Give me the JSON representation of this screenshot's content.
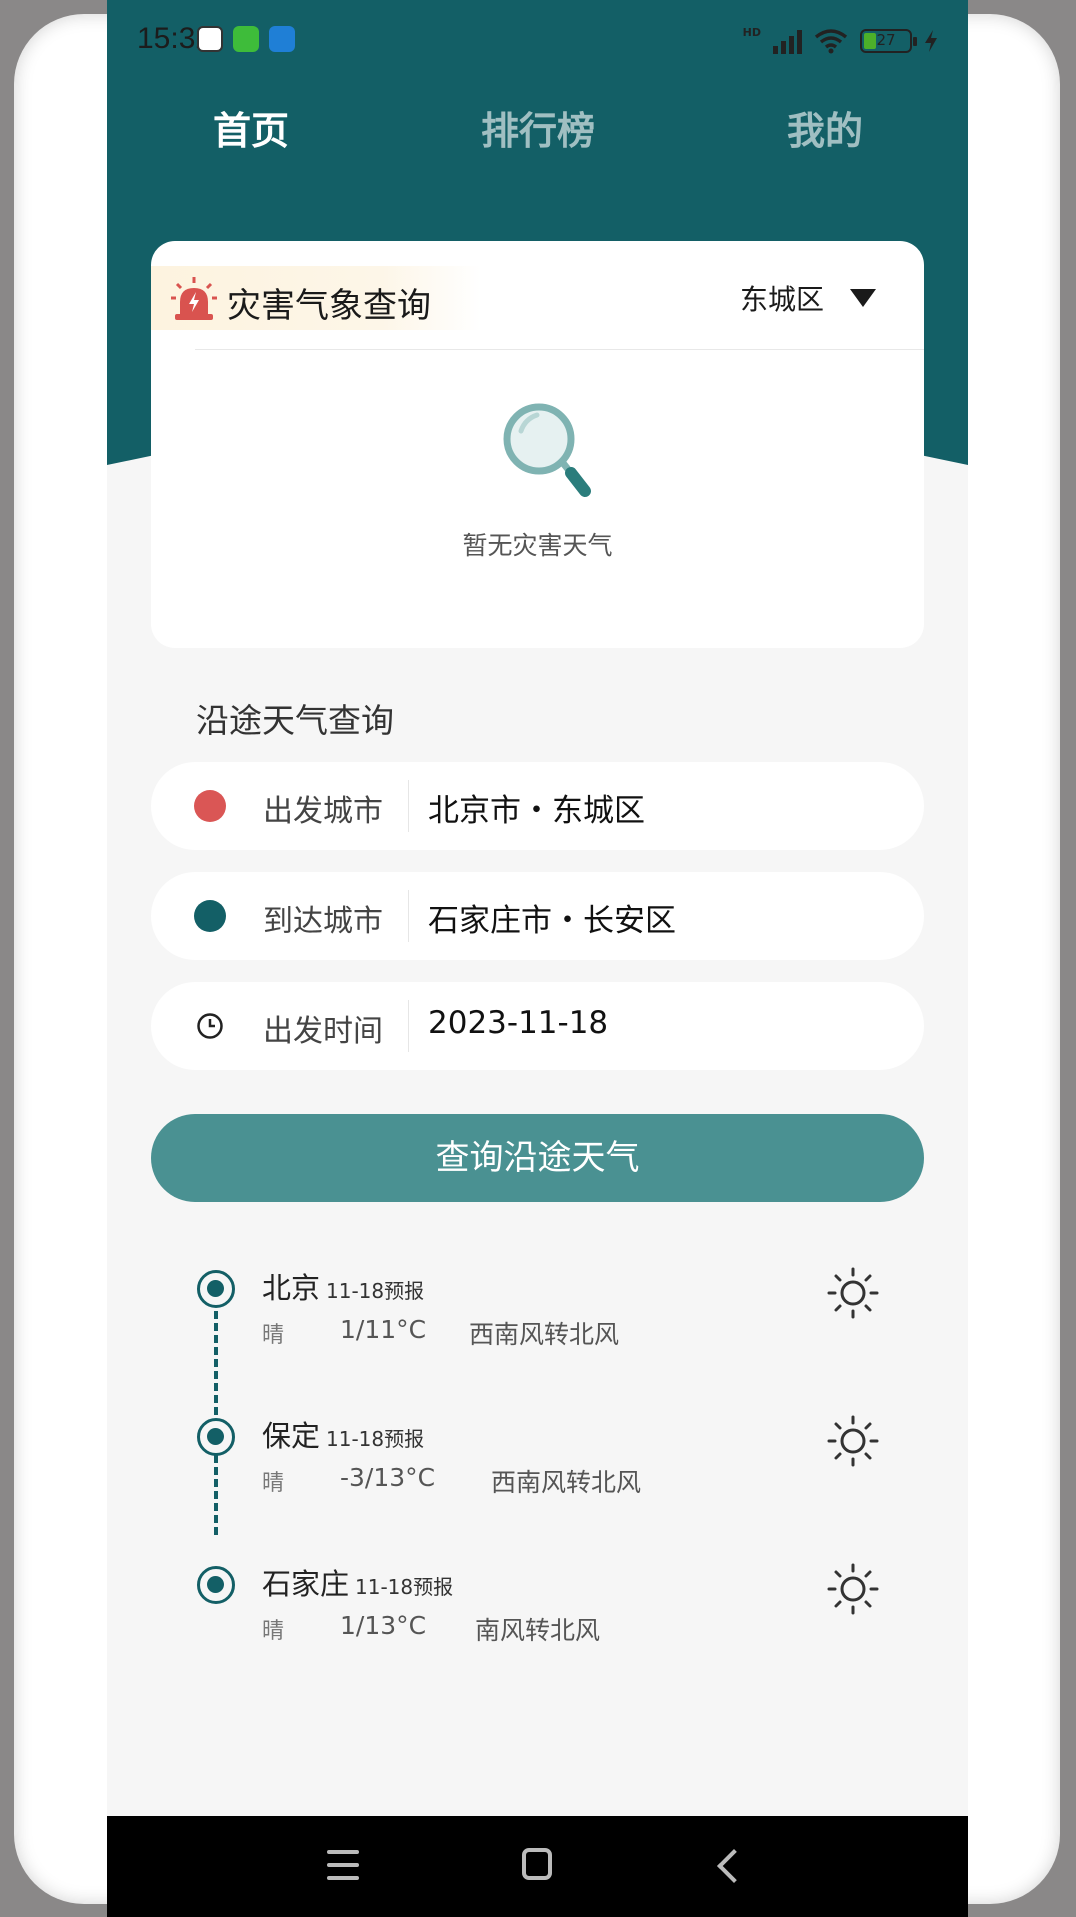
{
  "status_bar": {
    "time": "15:32",
    "app_icons": [
      "robot-app-icon",
      "smile-app-icon",
      "blue-app-icon"
    ],
    "network_label": "HD",
    "battery_level": "27",
    "charging": true
  },
  "tabs": [
    {
      "label": "首页",
      "active": true
    },
    {
      "label": "排行榜",
      "active": false
    },
    {
      "label": "我的",
      "active": false
    }
  ],
  "disaster": {
    "title": "灾害气象查询",
    "region": "东城区",
    "empty_text": "暂无灾害天气"
  },
  "route": {
    "title": "沿途天气查询",
    "departure": {
      "label": "出发城市",
      "value": "北京市・东城区"
    },
    "arrival": {
      "label": "到达城市",
      "value": "石家庄市・长安区"
    },
    "time": {
      "label": "出发时间",
      "value": "2023-11-18"
    },
    "query_button": "查询沿途天气"
  },
  "forecasts": [
    {
      "city": "北京",
      "date_label": "11-18预报",
      "weather": "晴",
      "temp": "1/11°C",
      "wind": "西南风转北风"
    },
    {
      "city": "保定",
      "date_label": "11-18预报",
      "weather": "晴",
      "temp": "-3/13°C",
      "wind": "西南风转北风"
    },
    {
      "city": "石家庄",
      "date_label": "11-18预报",
      "weather": "晴",
      "temp": "1/13°C",
      "wind": "南风转北风"
    }
  ],
  "colors": {
    "primary": "#135f66",
    "button": "#4a9192",
    "departure_dot": "#da5655",
    "alarm": "#d9534f"
  }
}
